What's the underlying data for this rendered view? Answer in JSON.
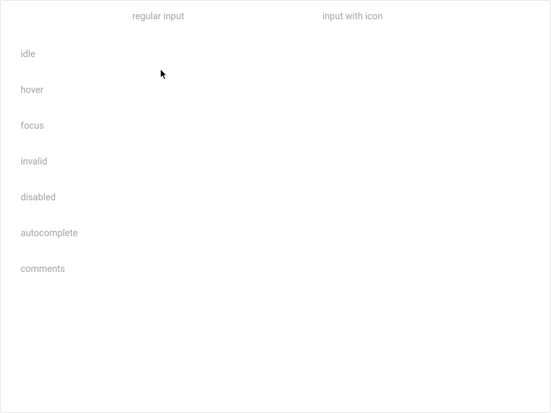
{
  "columns": {
    "regular": "regular input",
    "with_icon": "input with icon"
  },
  "rows": {
    "idle": "idle",
    "hover": "hover",
    "focus": "focus",
    "invalid": "invalid",
    "disabled": "disabled",
    "autocomplete": "autocomplete",
    "comments": "comments"
  }
}
